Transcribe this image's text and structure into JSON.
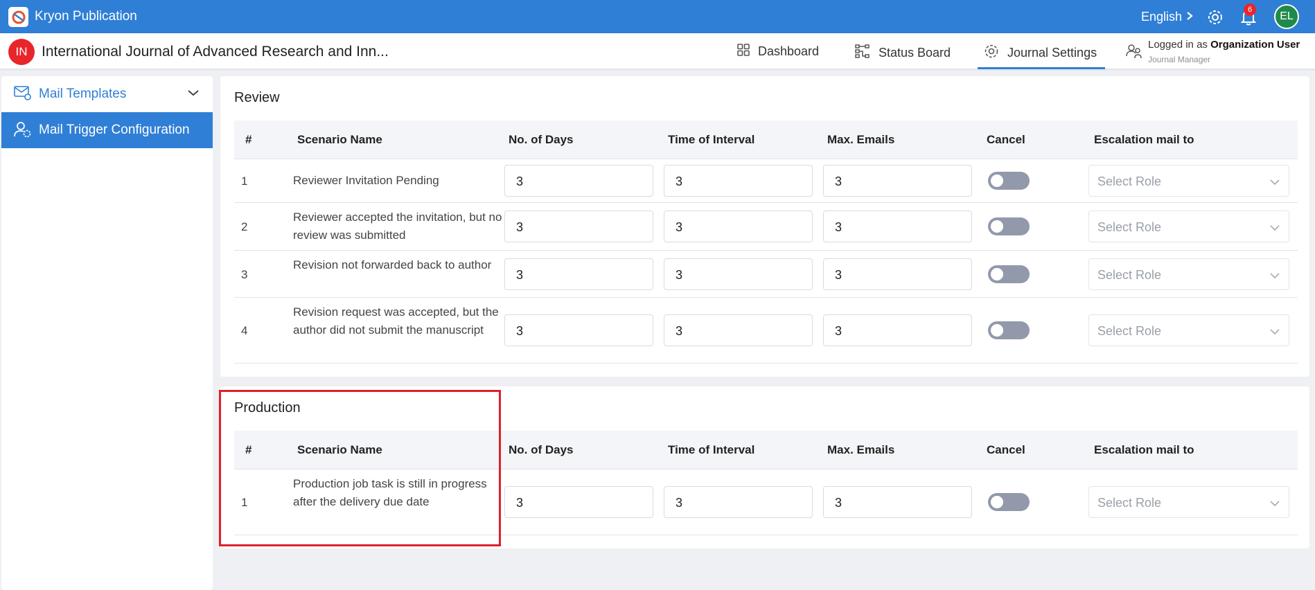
{
  "app": {
    "title": "Kryon Publication"
  },
  "topbar": {
    "language": "English",
    "notification_count": "6",
    "avatar_initials": "EL"
  },
  "journal": {
    "initials": "IN",
    "title": "International Journal of Advanced Research and Inn..."
  },
  "nav": {
    "dashboard": "Dashboard",
    "status_board": "Status Board",
    "journal_settings": "Journal Settings"
  },
  "user": {
    "logged_prefix": "Logged in as",
    "name": "Organization User",
    "role": "Journal Manager"
  },
  "sidebar": {
    "items": [
      {
        "label": "Mail Templates"
      },
      {
        "label": "Mail Trigger Configuration"
      }
    ]
  },
  "columns": {
    "num": "#",
    "scenario": "Scenario Name",
    "days": "No. of Days",
    "interval": "Time of Interval",
    "max_emails": "Max. Emails",
    "cancel": "Cancel",
    "escalation": "Escalation mail to"
  },
  "review": {
    "title": "Review",
    "rows": [
      {
        "num": "1",
        "name": "Reviewer Invitation Pending",
        "days": "3",
        "interval": "3",
        "max": "3",
        "role": "Select Role"
      },
      {
        "num": "2",
        "name": "Reviewer accepted the invitation, but no review was submitted",
        "days": "3",
        "interval": "3",
        "max": "3",
        "role": "Select Role"
      },
      {
        "num": "3",
        "name": "Revision not forwarded back to author",
        "days": "3",
        "interval": "3",
        "max": "3",
        "role": "Select Role"
      },
      {
        "num": "4",
        "name": "Revision request was accepted, but the author did not submit the manuscript",
        "days": "3",
        "interval": "3",
        "max": "3",
        "role": "Select Role"
      }
    ]
  },
  "production": {
    "title": "Production",
    "rows": [
      {
        "num": "1",
        "name": "Production job task is still in progress after the delivery due date",
        "days": "3",
        "interval": "3",
        "max": "3",
        "role": "Select Role"
      }
    ]
  }
}
